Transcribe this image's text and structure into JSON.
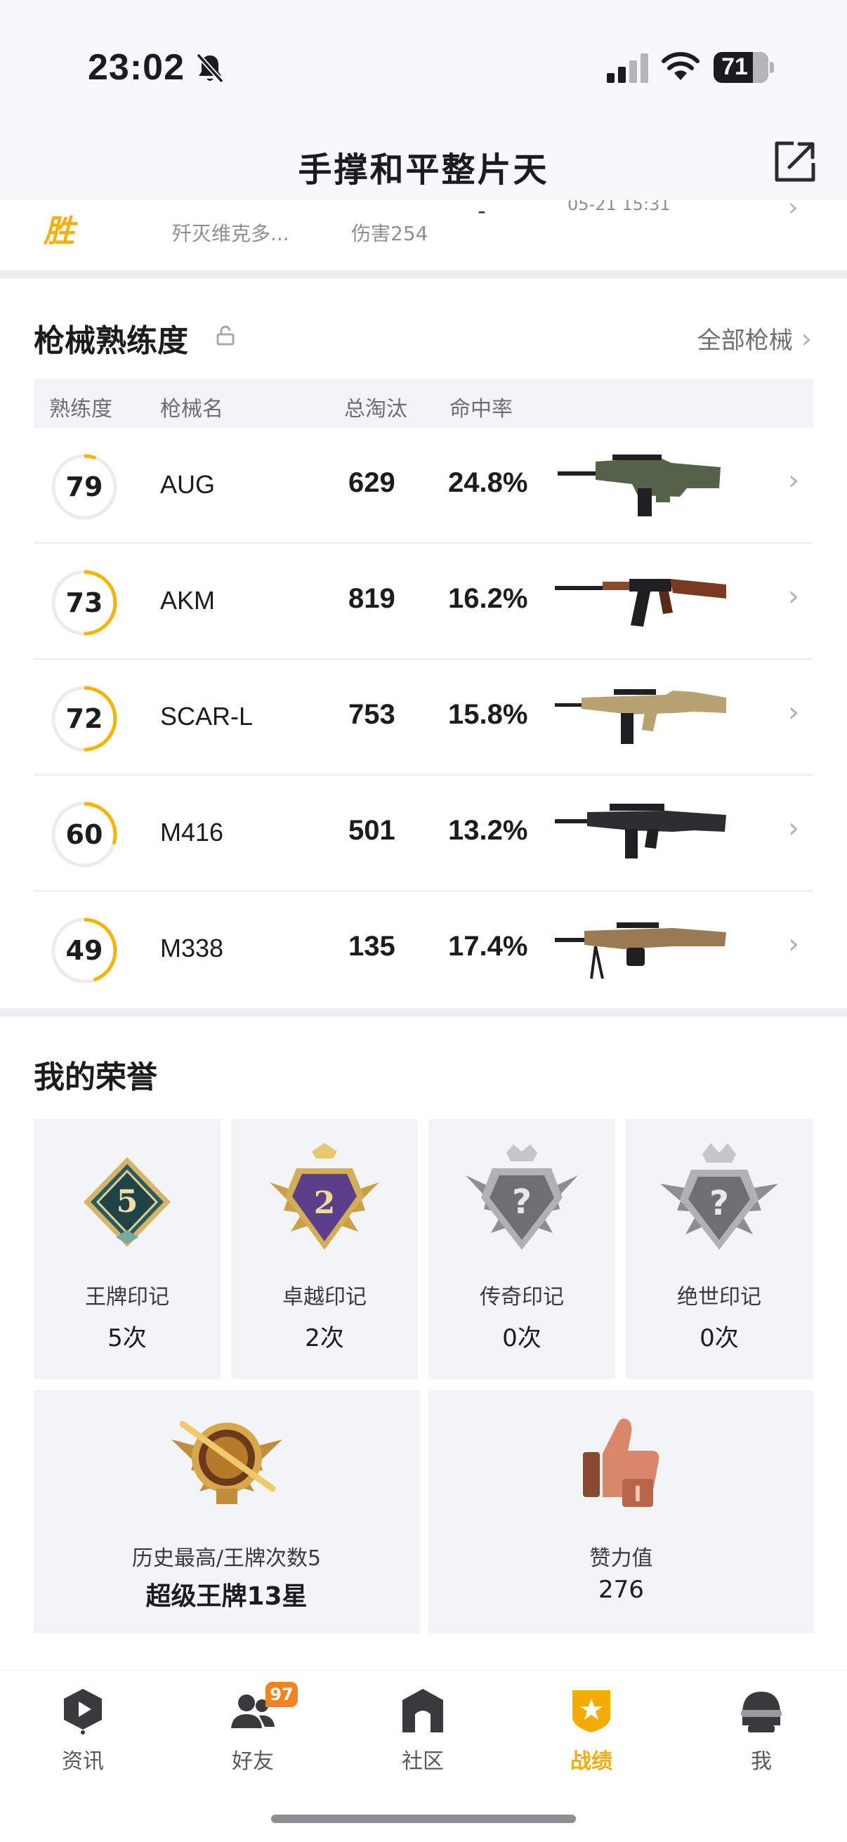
{
  "status_bar": {
    "time": "23:02",
    "battery": "71"
  },
  "header": {
    "title": "手撑和平整片天"
  },
  "match": {
    "result": "胜",
    "map": "歼灭维克多...",
    "damage": "伤害254",
    "time_fragment": "05-21 15:31",
    "placement": "-"
  },
  "weapons": {
    "title": "枪械熟练度",
    "all_link": "全部枪械",
    "columns": {
      "mastery": "熟练度",
      "name": "枪械名",
      "kills": "总淘汰",
      "accuracy": "命中率"
    },
    "rows": [
      {
        "mastery": "79",
        "mastery_fraction": 0.06,
        "name": "AUG",
        "kills": "629",
        "accuracy": "24.8%",
        "image": "rifle-aug",
        "color": "#55624a"
      },
      {
        "mastery": "73",
        "mastery_fraction": 0.5,
        "name": "AKM",
        "kills": "819",
        "accuracy": "16.2%",
        "image": "rifle-akm",
        "color": "#7a3a22"
      },
      {
        "mastery": "72",
        "mastery_fraction": 0.5,
        "name": "SCAR-L",
        "kills": "753",
        "accuracy": "15.8%",
        "image": "rifle-scar",
        "color": "#b8a172"
      },
      {
        "mastery": "60",
        "mastery_fraction": 0.3,
        "name": "M416",
        "kills": "501",
        "accuracy": "13.2%",
        "image": "rifle-m416",
        "color": "#2e2e30"
      },
      {
        "mastery": "49",
        "mastery_fraction": 0.45,
        "name": "M338",
        "kills": "135",
        "accuracy": "17.4%",
        "image": "lmg-m338",
        "color": "#9a7a52"
      }
    ]
  },
  "honors": {
    "title": "我的荣誉",
    "badges": [
      {
        "label": "王牌印记",
        "value": "5次",
        "emblem_text": "5",
        "icon": "ace-badge-icon"
      },
      {
        "label": "卓越印记",
        "value": "2次",
        "emblem_text": "2",
        "icon": "excellence-badge-icon"
      },
      {
        "label": "传奇印记",
        "value": "0次",
        "emblem_text": "?",
        "icon": "legend-badge-locked-icon"
      },
      {
        "label": "绝世印记",
        "value": "0次",
        "emblem_text": "?",
        "icon": "peerless-badge-locked-icon"
      }
    ],
    "highest": {
      "label": "历史最高/王牌次数5",
      "value": "超级王牌13星",
      "icon": "rank-emblem-icon"
    },
    "likes": {
      "label": "赞力值",
      "value": "276",
      "icon": "thumbs-up-icon"
    }
  },
  "tabs": [
    {
      "label": "资讯",
      "icon": "news-icon",
      "active": false
    },
    {
      "label": "好友",
      "icon": "friends-icon",
      "active": false,
      "badge": "97"
    },
    {
      "label": "社区",
      "icon": "community-icon",
      "active": false
    },
    {
      "label": "战绩",
      "icon": "record-icon",
      "active": true
    },
    {
      "label": "我",
      "icon": "profile-icon",
      "active": false
    }
  ],
  "colors": {
    "accent": "#f3ac00",
    "ring": "#f5b400",
    "badge": "#f58220"
  }
}
